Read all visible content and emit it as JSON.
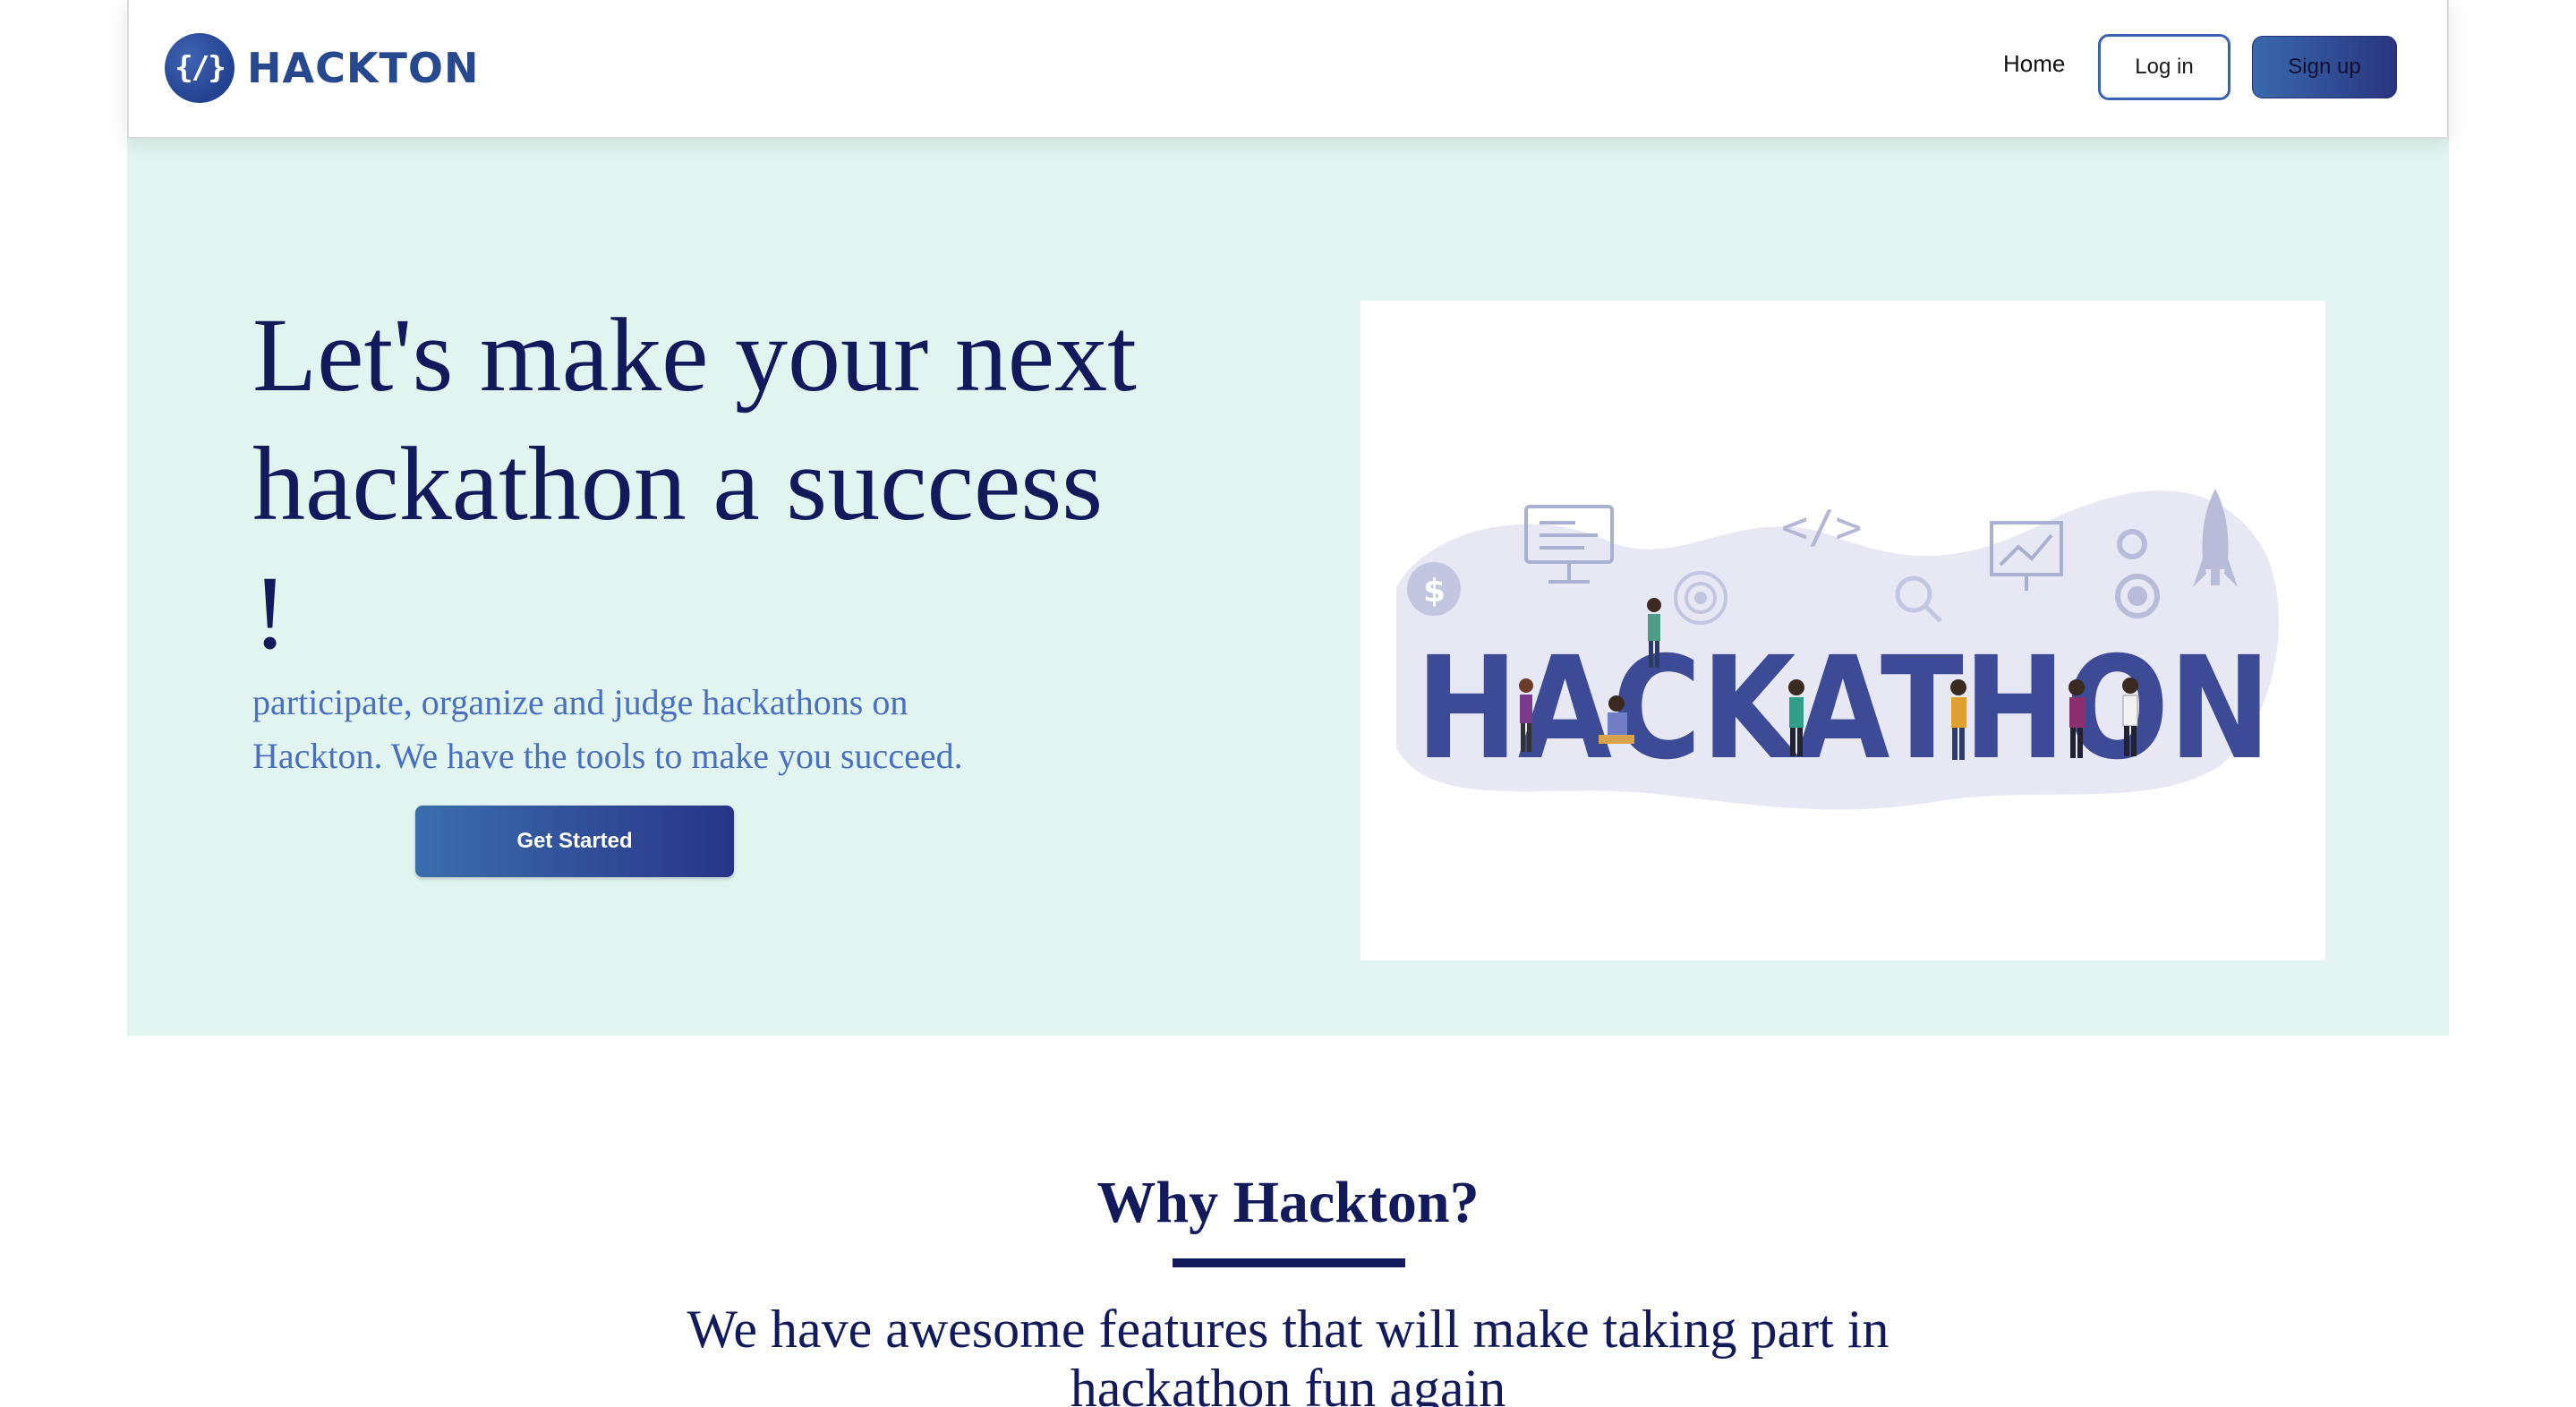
{
  "brand": {
    "logo_glyph": "{/}",
    "name": "HACKTON",
    "color": "#27478f"
  },
  "nav": {
    "home_label": "Home",
    "login_label": "Log in",
    "signup_label": "Sign up"
  },
  "hero": {
    "title": "Let's make your next hackathon a success !",
    "subtitle": "participate, organize and judge hackathons on Hackton. We have the tools to make you succeed.",
    "cta_label": "Get Started",
    "background": "#e2f4ef",
    "image": {
      "word": "HACKATHON",
      "code_glyph": "</>",
      "dollar_glyph": "$",
      "icons": [
        "monitor-icon",
        "code-icon",
        "chart-board-icon",
        "gear-icon",
        "rocket-icon",
        "dollar-icon",
        "target-icon",
        "magnifier-icon"
      ]
    }
  },
  "why": {
    "title": "Why Hackton?",
    "subtitle": "We have awesome features that will make taking part in hackathon fun again"
  },
  "colors": {
    "heading": "#121a5c",
    "accent": "#3a63b8",
    "subtitle": "#4a6fc0"
  }
}
